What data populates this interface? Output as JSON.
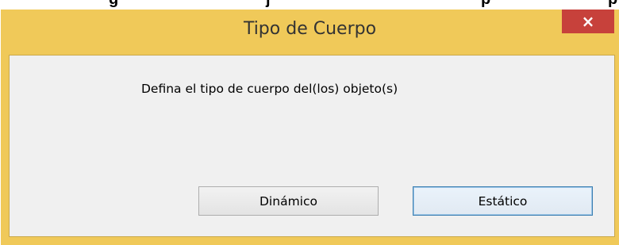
{
  "background_fragment": [
    "g",
    "j",
    "p",
    "p"
  ],
  "dialog": {
    "title": "Tipo de Cuerpo",
    "close_glyph": "×",
    "close_icon": "close-icon",
    "message": "Defina el tipo de cuerpo del(los) objeto(s)",
    "buttons": {
      "dynamic": "Dinámico",
      "static": "Estático"
    }
  },
  "colors": {
    "titlebar": "#f0c959",
    "close_button": "#c7413b",
    "client_area": "#f0f0f0",
    "focused_button_border": "#3c7fb1"
  }
}
